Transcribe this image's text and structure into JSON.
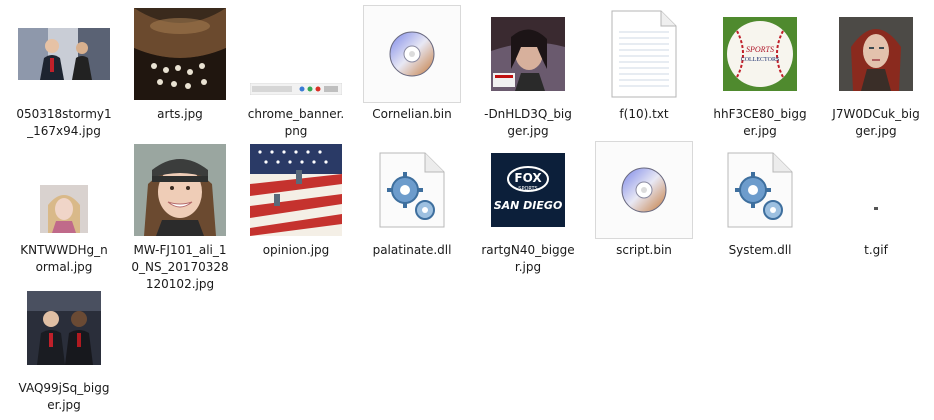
{
  "files": [
    {
      "name_lines": [
        "050318stormy1",
        "_167x94.jpg"
      ],
      "icon": "photo-thumbnail"
    },
    {
      "name_lines": [
        "arts.jpg"
      ],
      "icon": "photo-thumbnail"
    },
    {
      "name_lines": [
        "chrome_banner.",
        "png"
      ],
      "icon": "banner-thumbnail"
    },
    {
      "name_lines": [
        "Cornelian.bin"
      ],
      "icon": "disc-icon"
    },
    {
      "name_lines": [
        "-DnHLD3Q_big",
        "ger.jpg"
      ],
      "icon": "photo-thumbnail"
    },
    {
      "name_lines": [
        "f(10).txt"
      ],
      "icon": "text-file-icon"
    },
    {
      "name_lines": [
        "hhF3CE80_bigg",
        "er.jpg"
      ],
      "icon": "baseball-thumbnail"
    },
    {
      "name_lines": [
        "J7W0DCuk_big",
        "ger.jpg"
      ],
      "icon": "portrait-thumbnail"
    },
    {
      "name_lines": [
        "KNTWWDHg_n",
        "ormal.jpg"
      ],
      "icon": "portrait-thumbnail"
    },
    {
      "name_lines": [
        "MW-FJ101_ali_1",
        "0_NS_20170328",
        "120102.jpg"
      ],
      "icon": "portrait-thumbnail"
    },
    {
      "name_lines": [
        "opinion.jpg"
      ],
      "icon": "flag-thumbnail"
    },
    {
      "name_lines": [
        "palatinate.dll"
      ],
      "icon": "gears-file-icon"
    },
    {
      "name_lines": [
        "rartgN40_bigge",
        "r.jpg"
      ],
      "icon": "logo-thumbnail"
    },
    {
      "name_lines": [
        "script.bin"
      ],
      "icon": "disc-icon"
    },
    {
      "name_lines": [
        "System.dll"
      ],
      "icon": "gears-file-icon"
    },
    {
      "name_lines": [
        "t.gif"
      ],
      "icon": "tiny-gif-icon"
    },
    {
      "name_lines": [
        "VAQ99jSq_bigg",
        "er.jpg"
      ],
      "icon": "photo-thumbnail"
    }
  ],
  "logo_text": {
    "top": "FOX",
    "sub": "SPORTS",
    "bottom": "SAN DIEGO"
  },
  "baseball_text": {
    "line1": "SPORTS",
    "line2": "COLLECTORS"
  },
  "colors": {
    "selection_border": "#d9d9d9",
    "fox_bg": "#0c1f3a",
    "label_text": "#1a1a1a"
  }
}
